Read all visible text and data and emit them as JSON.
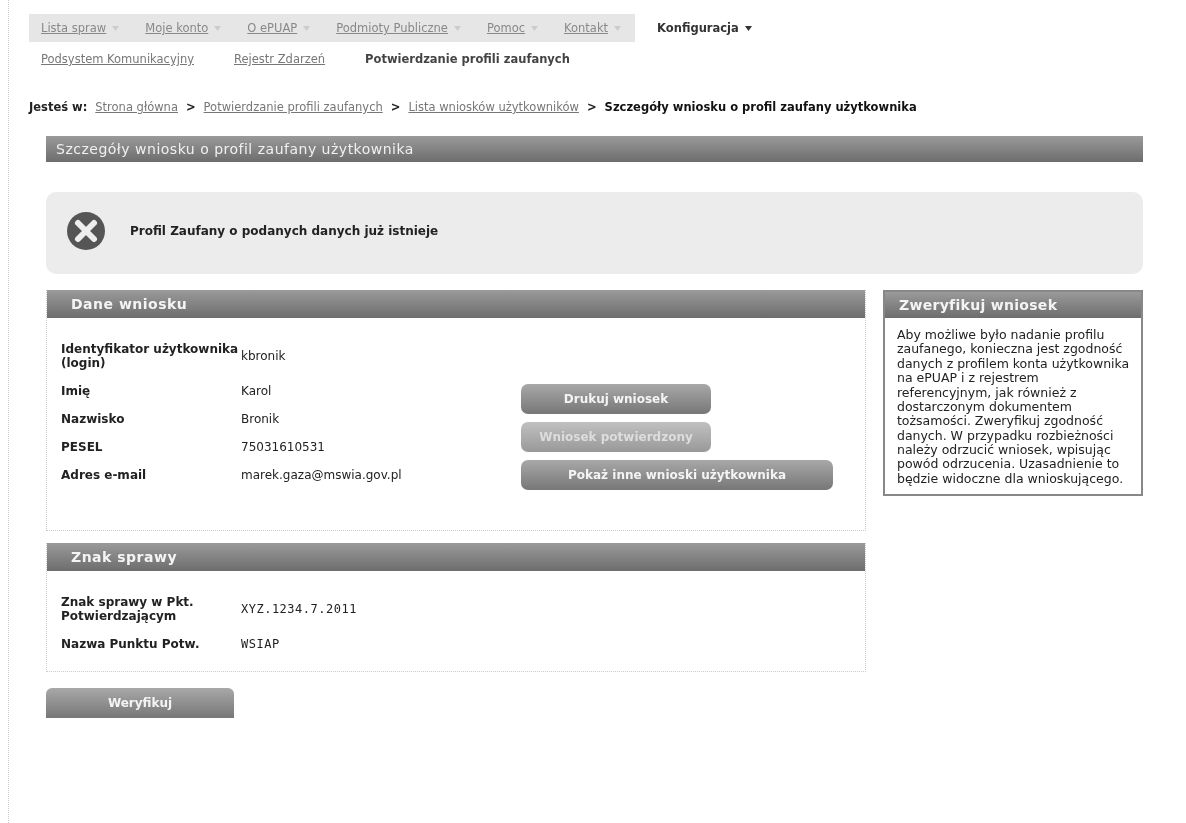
{
  "nav": {
    "items": [
      {
        "label": "Lista spraw",
        "selected": false,
        "has_menu": true
      },
      {
        "label": "Moje konto",
        "selected": false,
        "has_menu": true
      },
      {
        "label": "O ePUAP",
        "selected": false,
        "has_menu": true
      },
      {
        "label": "Podmioty Publiczne",
        "selected": false,
        "has_menu": true
      },
      {
        "label": "Pomoc",
        "selected": false,
        "has_menu": true
      },
      {
        "label": "Kontakt",
        "selected": false,
        "has_menu": true
      },
      {
        "label": "Konfiguracja",
        "selected": true,
        "has_menu": true
      }
    ]
  },
  "subnav": {
    "items": [
      {
        "label": "Podsystem Komunikacyjny",
        "selected": false
      },
      {
        "label": "Rejestr Zdarzeń",
        "selected": false
      },
      {
        "label": "Potwierdzanie profili zaufanych",
        "selected": true
      }
    ]
  },
  "breadcrumb": {
    "prefix": "Jesteś w:",
    "items": [
      {
        "label": "Strona główna",
        "current": false
      },
      {
        "label": "Potwierdzanie profili zaufanych",
        "current": false
      },
      {
        "label": "Lista wniosków użytkowników",
        "current": false
      },
      {
        "label": "Szczegóły wniosku o profil zaufany użytkownika",
        "current": true
      }
    ],
    "separator": ">"
  },
  "page_title": "Szczegóły wniosku o profil zaufany użytkownika",
  "alert": {
    "kind": "error",
    "message": "Profil Zaufany o podanych danych już istnieje"
  },
  "application_panel": {
    "title": "Dane wniosku",
    "fields": [
      {
        "label": "Identyfikator użytkownika (login)",
        "value": "kbronik"
      },
      {
        "label": "Imię",
        "value": "Karol"
      },
      {
        "label": "Nazwisko",
        "value": "Bronik"
      },
      {
        "label": "PESEL",
        "value": "75031610531"
      },
      {
        "label": "Adres e-mail",
        "value": "marek.gaza@mswia.gov.pl"
      }
    ],
    "buttons": [
      {
        "label": "Drukuj wniosek",
        "disabled": false,
        "wide": false
      },
      {
        "label": "Wniosek potwierdzony",
        "disabled": true,
        "wide": false
      },
      {
        "label": "Pokaż inne wnioski użytkownika",
        "disabled": false,
        "wide": true
      }
    ]
  },
  "case_panel": {
    "title": "Znak sprawy",
    "fields": [
      {
        "label": "Znak sprawy w Pkt. Potwierdzającym",
        "value": "XYZ.1234.7.2011"
      },
      {
        "label": "Nazwa Punktu Potw.",
        "value": "WSIAP"
      }
    ]
  },
  "verify_panel": {
    "title": "Zweryfikuj wniosek",
    "text": "Aby możliwe było nadanie profilu zaufanego, konieczna jest zgodność danych z profilem konta użytkownika na ePUAP i z rejestrem referencyjnym, jak również z dostarczonym dokumentem tożsamości. Zweryfikuj zgodność danych. W przypadku rozbieżności należy odrzucić wniosek, wpisując powód odrzucenia. Uzasadnienie to będzie widoczne dla wnioskującego."
  },
  "verify_button": {
    "label": "Weryfikuj"
  }
}
